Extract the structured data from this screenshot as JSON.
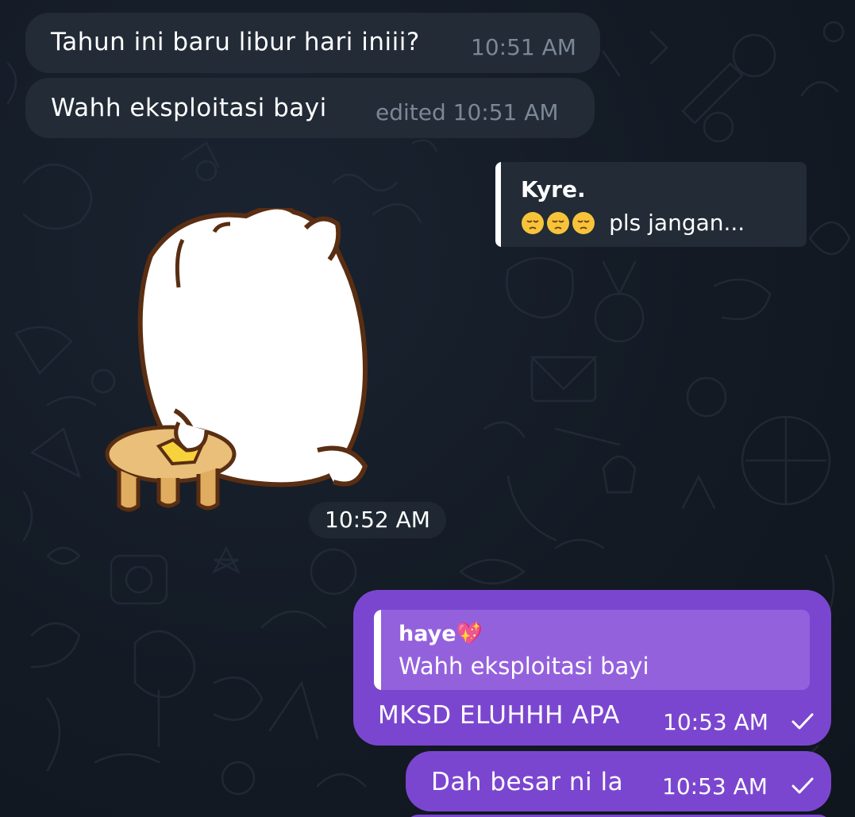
{
  "messages": {
    "incoming_1": {
      "text": "Tahun ini baru libur hari iniii?",
      "time": "10:51 AM"
    },
    "incoming_2": {
      "text": "Wahh eksploitasi bayi",
      "time": "edited 10:51 AM"
    },
    "reply_card": {
      "name": "Kyre.",
      "text": "pls jangan..."
    },
    "sticker": {
      "time": "10:52 AM"
    },
    "outgoing_1": {
      "quote_name": "haye💖",
      "quote_text": "Wahh eksploitasi bayi",
      "text": "MKSD ELUHHH APA",
      "time": "10:53 AM"
    },
    "outgoing_2": {
      "text": "Dah besar ni la",
      "time": "10:53 AM"
    }
  },
  "icons": {
    "read_check": "check-icon",
    "pensive_emoji": "pensive-face-icon",
    "sticker": "cat-sticker"
  },
  "colors": {
    "background": "#131a24",
    "incoming_bubble": "#222b36",
    "outgoing_bubble": "#7b46cf",
    "quote_box": "#9461dd",
    "time_muted": "#7c8796"
  }
}
